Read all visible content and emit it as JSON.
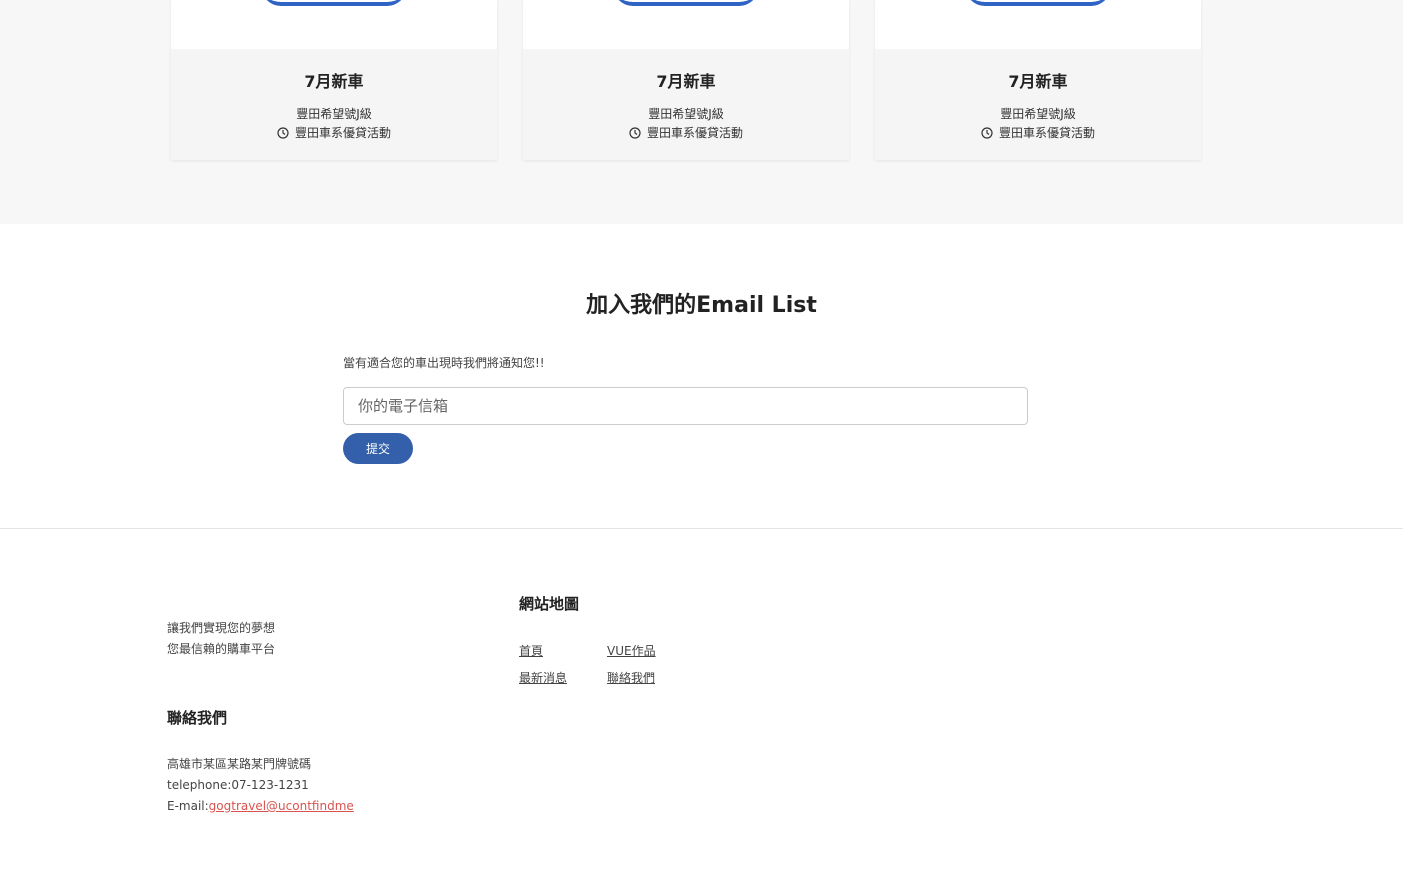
{
  "cards": [
    {
      "title": "7月新車",
      "subtitle": "豐田希望號J級",
      "promo": "豐田車系優貸活動",
      "icon": "clock-icon"
    },
    {
      "title": "7月新車",
      "subtitle": "豐田希望號J級",
      "promo": "豐田車系優貸活動",
      "icon": "clock-icon"
    },
    {
      "title": "7月新車",
      "subtitle": "豐田希望號J級",
      "promo": "豐田車系優貸活動",
      "icon": "clock-icon"
    }
  ],
  "newsletter": {
    "title": "加入我們的Email List",
    "description": "當有適合您的車出現時我們將通知您!!",
    "placeholder": "你的電子信箱",
    "submit_label": "提交",
    "button_color": "#3460ab"
  },
  "footer": {
    "slogan_line1": "讓我們實現您的夢想",
    "slogan_line2": "您最信賴的購車平台",
    "contact_heading": "聯絡我們",
    "address": "高雄市某區某路某門牌號碼",
    "telephone": "telephone:07-123-1231",
    "email_label": "E-mail:",
    "email_link": "gogtravel@ucontfindme",
    "sitemap_heading": "網站地圖",
    "sitemap_links": [
      "首頁",
      "VUE作品",
      "最新消息",
      "聯絡我們"
    ],
    "link_color": "#d9534f"
  }
}
